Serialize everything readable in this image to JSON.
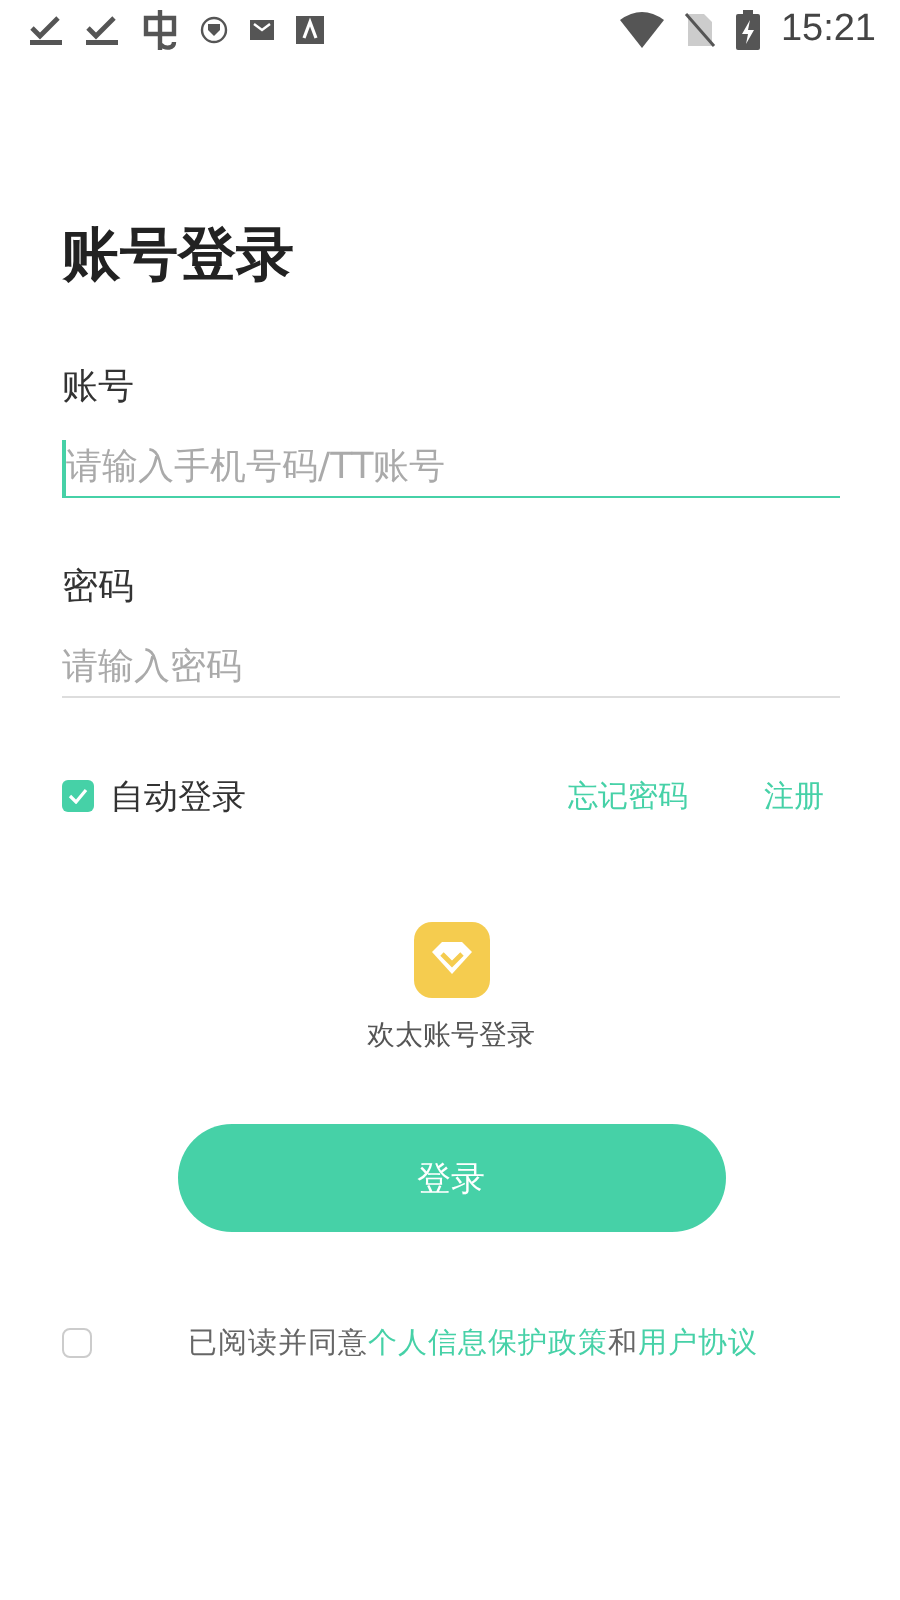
{
  "status_bar": {
    "time": "15:21"
  },
  "title": "账号登录",
  "fields": [
    {
      "label": "账号",
      "placeholder": "请输入手机号码/TT账号",
      "focused": true
    },
    {
      "label": "密码",
      "placeholder": "请输入密码",
      "focused": false
    }
  ],
  "auto_login": {
    "label": "自动登录",
    "checked": true
  },
  "links": [
    "忘记密码",
    "注册"
  ],
  "alt_login": {
    "label": "欢太账号登录"
  },
  "login_button": "登录",
  "agreement": {
    "checked": false,
    "parts": [
      {
        "kind": "text",
        "text": "已阅读并同意"
      },
      {
        "kind": "link",
        "text": "个人信息保护政策"
      },
      {
        "kind": "text",
        "text": "和"
      },
      {
        "kind": "link",
        "text": "用户协议"
      }
    ]
  }
}
